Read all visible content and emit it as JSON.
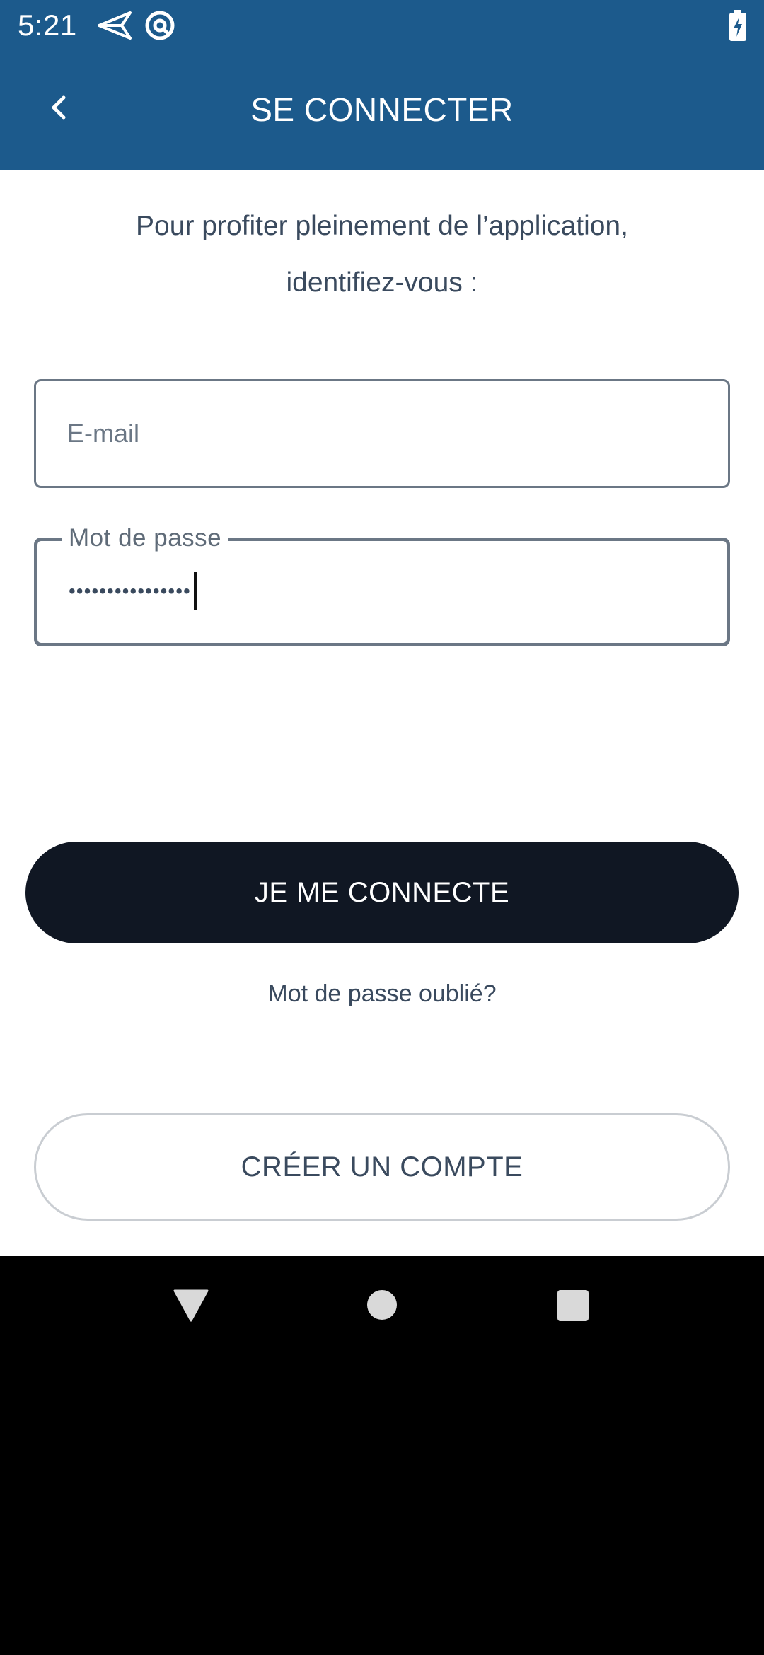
{
  "status_bar": {
    "time": "5:21",
    "icons": [
      "send-icon",
      "at-sign-icon",
      "battery-charging-icon"
    ]
  },
  "app_bar": {
    "title": "SE CONNECTER",
    "back_icon": "chevron-left-icon"
  },
  "intro": {
    "line1": "Pour profiter pleinement de l’application,",
    "line2": "identifiez-vous :"
  },
  "email_field": {
    "placeholder": "E-mail",
    "value": ""
  },
  "password_field": {
    "label": "Mot de passe",
    "masked_value": "••••••••••••••••"
  },
  "login_button": {
    "label": "JE ME CONNECTE"
  },
  "forgot_password": {
    "label": "Mot de passe oublié?"
  },
  "create_account_button": {
    "label": "CRÉER UN COMPTE"
  },
  "nav_bar": {
    "buttons": [
      "back-triangle-icon",
      "home-circle-icon",
      "recents-square-icon"
    ]
  },
  "colors": {
    "header": "#1c5a8c",
    "primary_button": "#101723",
    "text": "#3a4a5e"
  }
}
